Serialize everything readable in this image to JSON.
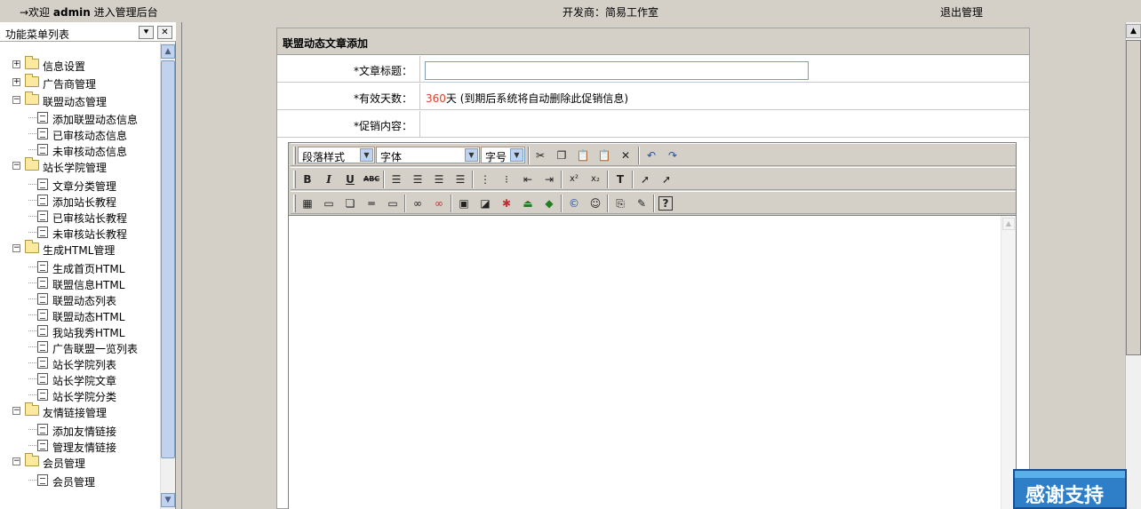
{
  "topbar": {
    "welcome_prefix": "→欢迎",
    "welcome_user": "admin",
    "welcome_suffix": "进入管理后台",
    "developer": "开发商：简易工作室",
    "logout": "退出管理"
  },
  "panel": {
    "title": "功能菜单列表",
    "collapse_glyph": "⯆",
    "close_glyph": "✕",
    "tree": [
      {
        "label": "信息设置",
        "type": "folder",
        "state": "+"
      },
      {
        "label": "广告商管理",
        "type": "folder",
        "state": "+"
      },
      {
        "label": "联盟动态管理",
        "type": "folder",
        "state": "−"
      },
      {
        "label": "添加联盟动态信息",
        "type": "leaf"
      },
      {
        "label": "已审核动态信息",
        "type": "leaf"
      },
      {
        "label": "未审核动态信息",
        "type": "leaf"
      },
      {
        "label": "站长学院管理",
        "type": "folder",
        "state": "−"
      },
      {
        "label": "文章分类管理",
        "type": "leaf"
      },
      {
        "label": "添加站长教程",
        "type": "leaf"
      },
      {
        "label": "已审核站长教程",
        "type": "leaf"
      },
      {
        "label": "未审核站长教程",
        "type": "leaf"
      },
      {
        "label": "生成HTML管理",
        "type": "folder",
        "state": "−"
      },
      {
        "label": "生成首页HTML",
        "type": "leaf"
      },
      {
        "label": "联盟信息HTML",
        "type": "leaf"
      },
      {
        "label": "联盟动态列表",
        "type": "leaf"
      },
      {
        "label": "联盟动态HTML",
        "type": "leaf"
      },
      {
        "label": "我站我秀HTML",
        "type": "leaf"
      },
      {
        "label": "广告联盟一览列表",
        "type": "leaf"
      },
      {
        "label": "站长学院列表",
        "type": "leaf"
      },
      {
        "label": "站长学院文章",
        "type": "leaf"
      },
      {
        "label": "站长学院分类",
        "type": "leaf"
      },
      {
        "label": "友情链接管理",
        "type": "folder",
        "state": "−"
      },
      {
        "label": "添加友情链接",
        "type": "leaf"
      },
      {
        "label": "管理友情链接",
        "type": "leaf"
      },
      {
        "label": "会员管理",
        "type": "folder",
        "state": "−"
      },
      {
        "label": "会员管理",
        "type": "leaf"
      }
    ]
  },
  "form": {
    "title": "联盟动态文章添加",
    "fields": {
      "article_title_label": "*文章标题：",
      "article_title_value": "",
      "valid_days_label": "*有效天数：",
      "valid_days_value": "360",
      "valid_days_note": "天 (到期后系统将自动删除此促销信息)",
      "content_label": "*促销内容："
    }
  },
  "editor": {
    "paragraph_style": "段落样式",
    "font": "字体",
    "font_size": "字号"
  },
  "badge": {
    "text": "感谢支持"
  }
}
